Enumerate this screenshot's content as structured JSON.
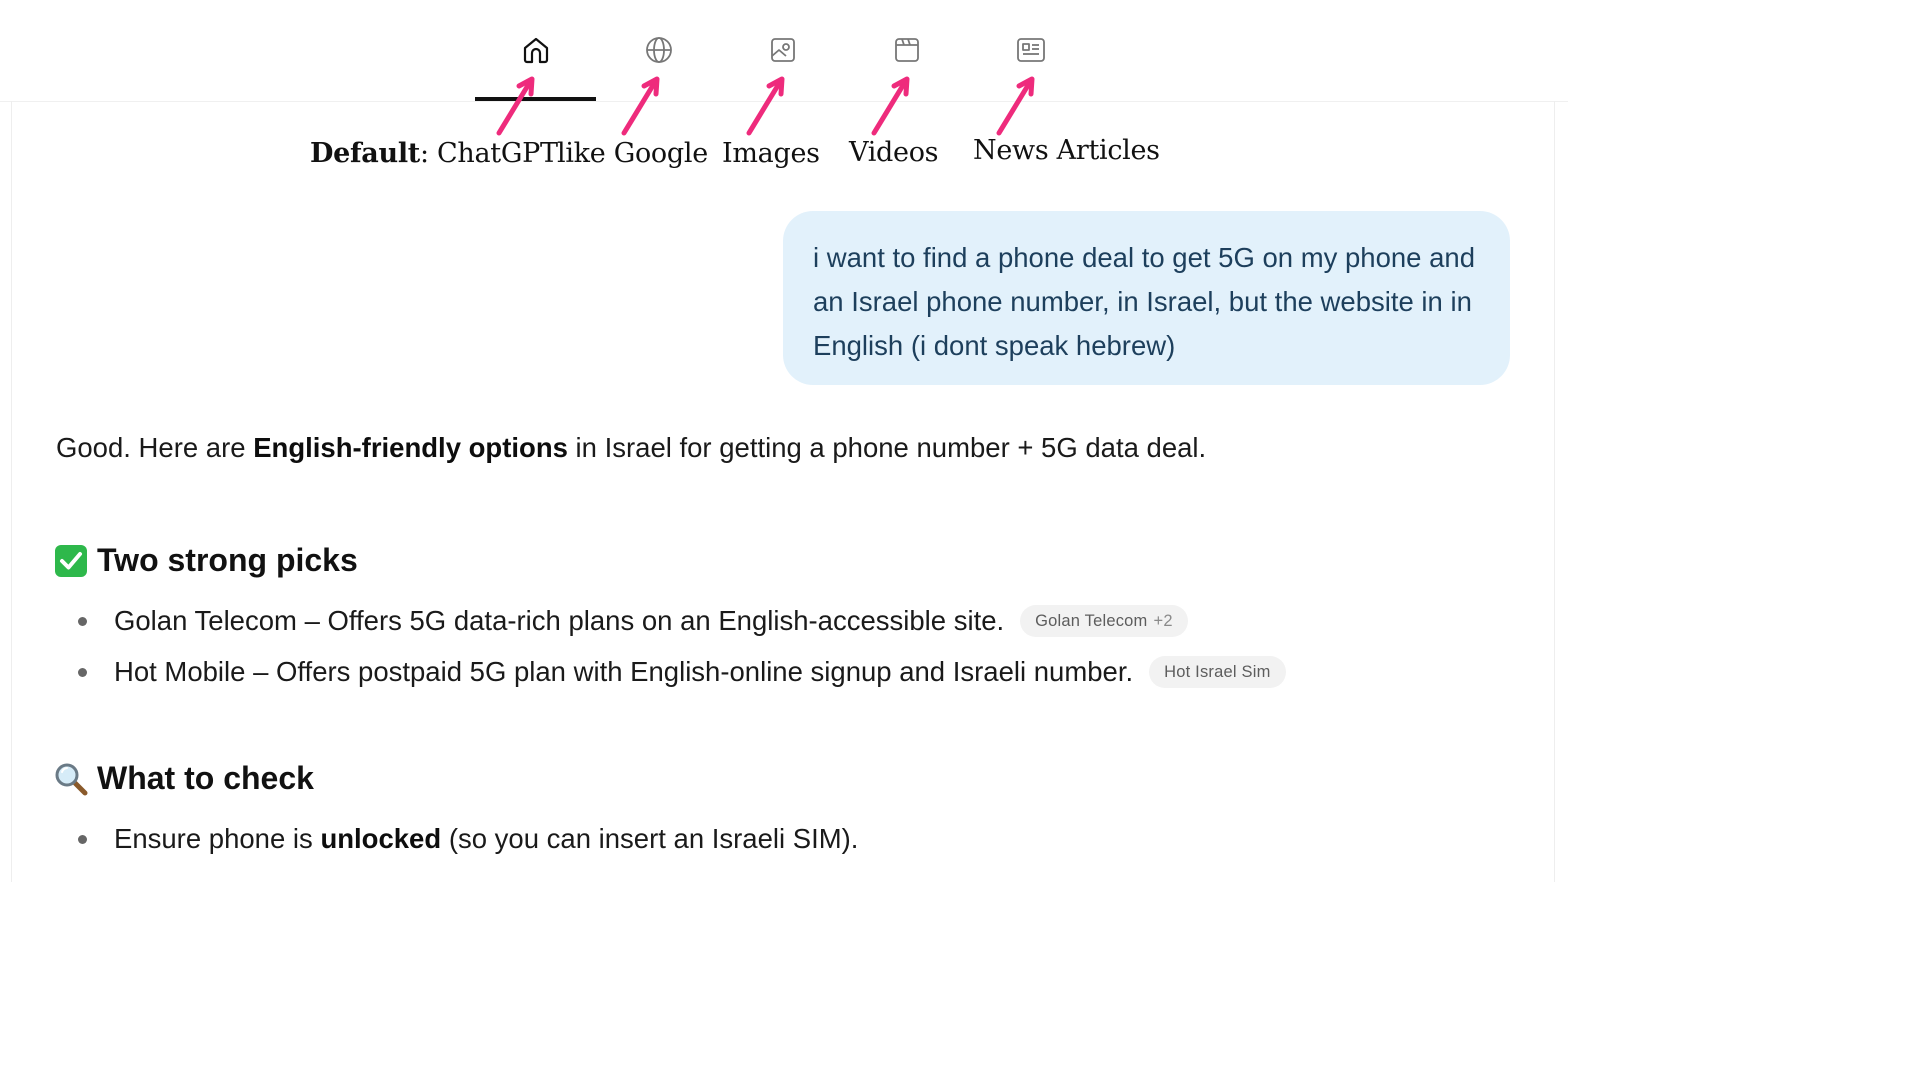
{
  "tabs": [
    {
      "icon": "home-icon",
      "selected": true
    },
    {
      "icon": "globe-icon",
      "selected": false
    },
    {
      "icon": "image-icon",
      "selected": false
    },
    {
      "icon": "video-icon",
      "selected": false
    },
    {
      "icon": "news-icon",
      "selected": false
    }
  ],
  "annotations": {
    "default_bold": "Default",
    "default_rest": ": ChatGPT",
    "google": "like Google",
    "images": "Images",
    "videos": "Videos",
    "news": "News Articles",
    "arrow_color": "#ee2b7c"
  },
  "user_message": "i want to find a phone deal to get 5G on my phone and an Israel phone number, in Israel, but the website in in English (i dont speak hebrew)",
  "answer": {
    "intro": {
      "a": "Good. Here are ",
      "b": "English-friendly options",
      "c": " in Israel for getting a phone number + 5G data deal."
    },
    "section1": {
      "emoji": "check-mark-icon",
      "title": "Two strong picks",
      "items": [
        {
          "text": "Golan Telecom – Offers 5G data-rich plans on an English-accessible site.",
          "chip": "Golan Telecom",
          "chip_extra": "+2"
        },
        {
          "text": "Hot Mobile – Offers postpaid 5G plan with English-online signup and Israeli number.",
          "chip": "Hot Israel Sim"
        }
      ]
    },
    "section2": {
      "emoji": "magnifier-icon",
      "title": "What to check",
      "items": [
        {
          "a": "Ensure phone is ",
          "b": "unlocked",
          "c": " (so you can insert an Israeli SIM)."
        }
      ]
    }
  },
  "colors": {
    "bubble_bg": "#e2f1fb",
    "check_green": "#2eb84b"
  }
}
